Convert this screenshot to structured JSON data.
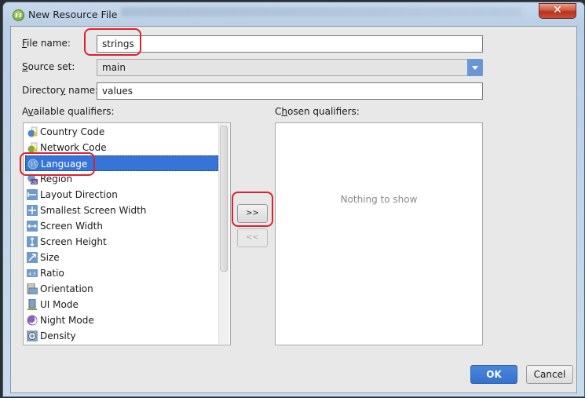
{
  "window": {
    "title": "New Resource File",
    "close_label": "✕"
  },
  "form": {
    "file_name": {
      "label_mnemonic": "F",
      "label_rest": "ile name:",
      "value": "strings"
    },
    "source_set": {
      "label_mnemonic": "S",
      "label_rest": "ource set:",
      "value": "main"
    },
    "directory_name": {
      "label_pre": "Director",
      "label_mnemonic": "y",
      "label_rest": " name:",
      "value": "values"
    }
  },
  "available_qualifiers": {
    "label_pre": "A",
    "label_mnemonic": "v",
    "label_rest": "ailable qualifiers:",
    "items": [
      {
        "label": "Country Code",
        "icon": "country-code-icon"
      },
      {
        "label": "Network Code",
        "icon": "network-code-icon"
      },
      {
        "label": "Language",
        "icon": "language-globe-icon",
        "selected": true
      },
      {
        "label": "Region",
        "icon": "region-icon"
      },
      {
        "label": "Layout Direction",
        "icon": "layout-direction-icon"
      },
      {
        "label": "Smallest Screen Width",
        "icon": "smallest-screen-width-icon"
      },
      {
        "label": "Screen Width",
        "icon": "screen-width-icon"
      },
      {
        "label": "Screen Height",
        "icon": "screen-height-icon"
      },
      {
        "label": "Size",
        "icon": "size-icon"
      },
      {
        "label": "Ratio",
        "icon": "ratio-icon"
      },
      {
        "label": "Orientation",
        "icon": "orientation-icon"
      },
      {
        "label": "UI Mode",
        "icon": "ui-mode-icon"
      },
      {
        "label": "Night Mode",
        "icon": "night-mode-icon"
      },
      {
        "label": "Density",
        "icon": "density-icon"
      }
    ]
  },
  "chosen_qualifiers": {
    "label_pre": "C",
    "label_mnemonic": "h",
    "label_rest": "osen qualifiers:",
    "empty_text": "Nothing to show"
  },
  "buttons": {
    "add": ">>",
    "remove": "<<",
    "ok": "OK",
    "cancel": "Cancel"
  },
  "colors": {
    "selection": "#3774d8",
    "highlight_annotation": "#d9232f",
    "primary_button": "#3672cc"
  }
}
